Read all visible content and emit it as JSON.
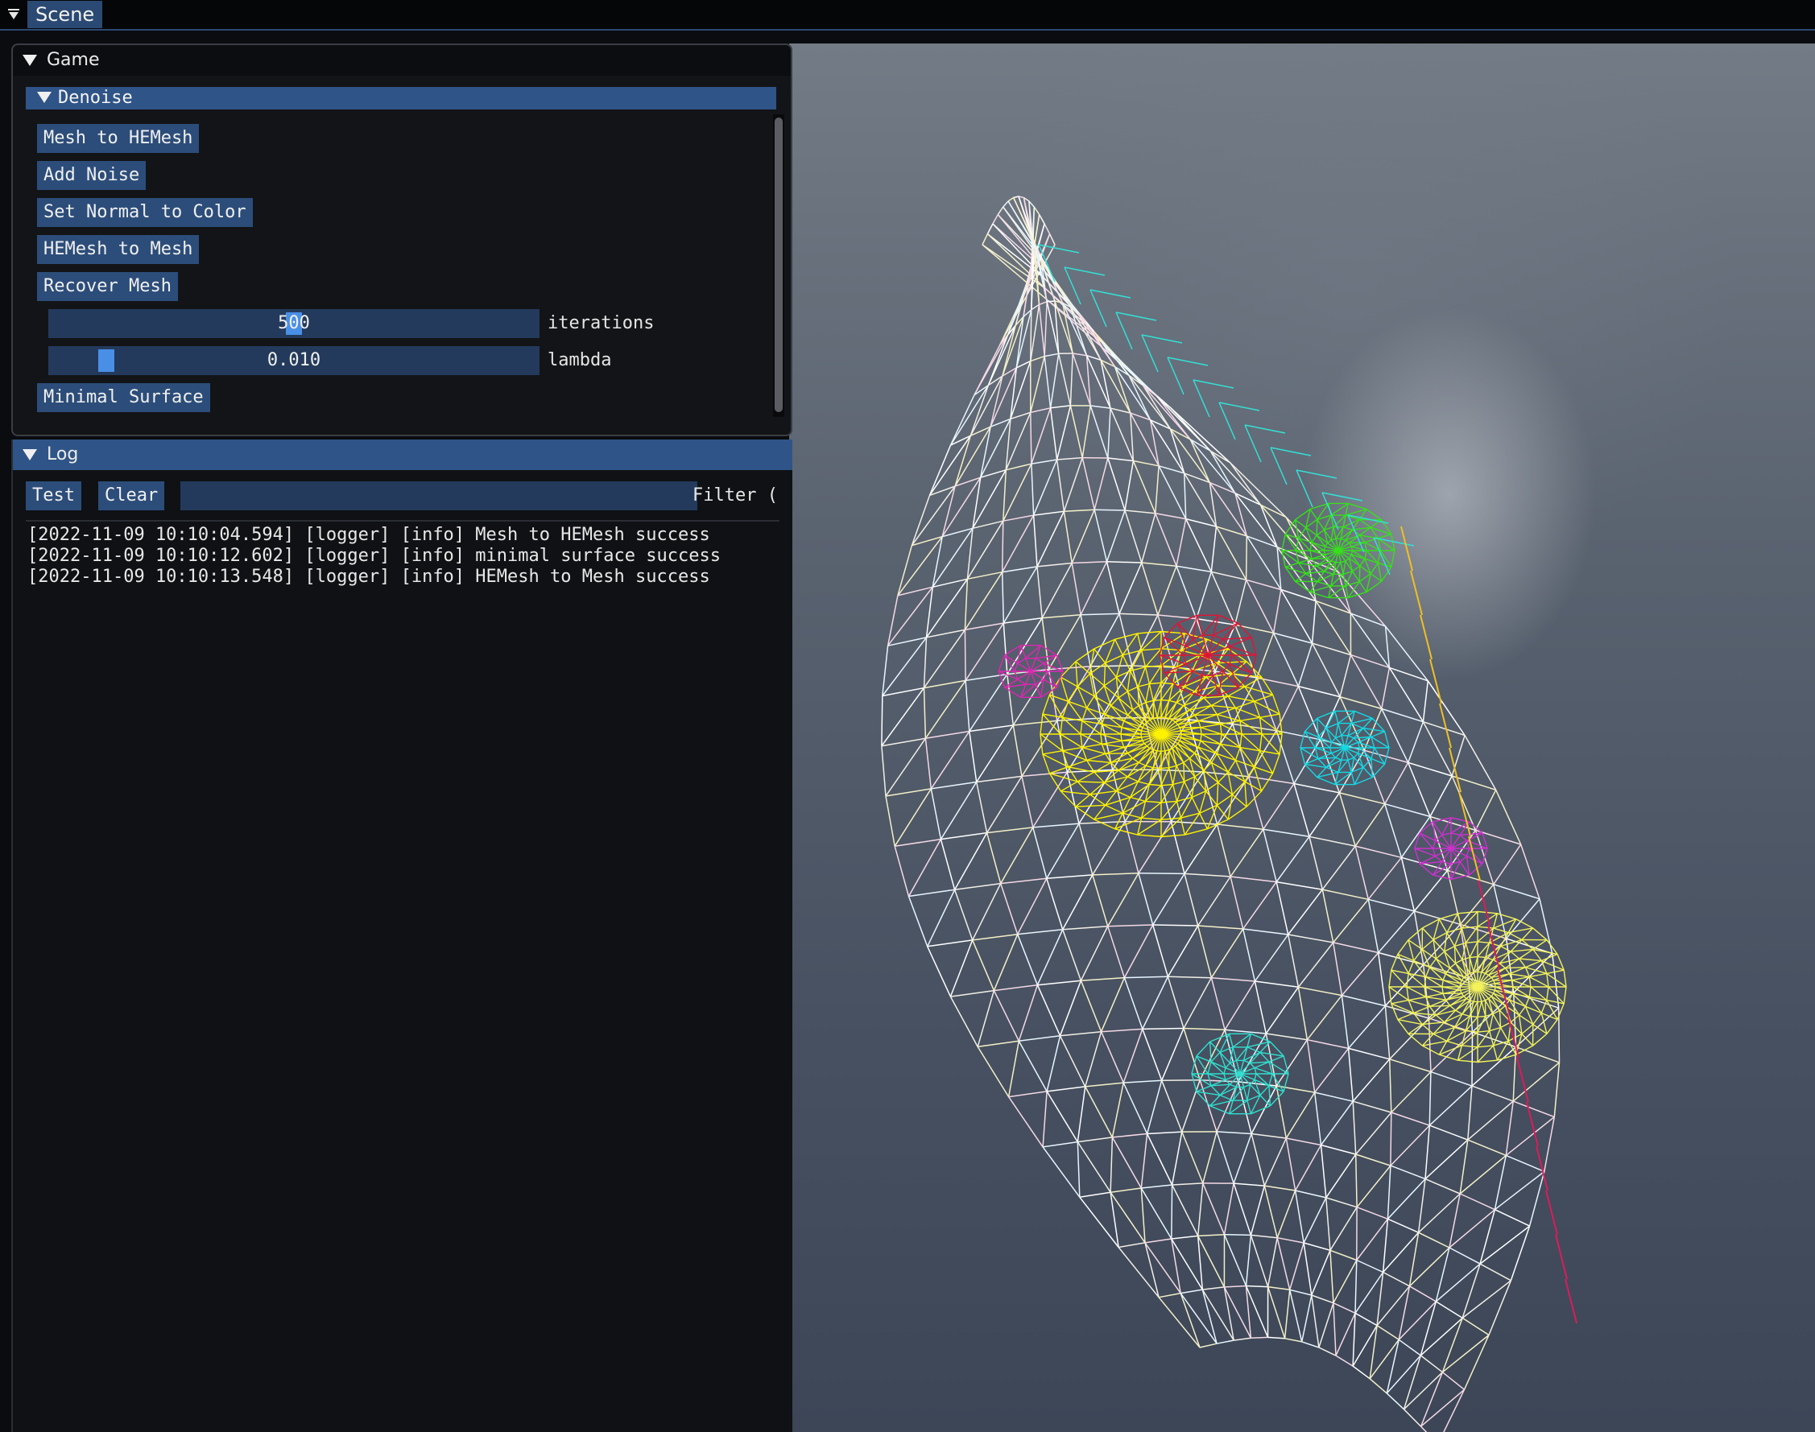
{
  "scene_tab": "Scene",
  "game": {
    "title": "Game",
    "section": "Denoise",
    "buttons": [
      "Mesh to HEMesh",
      "Add Noise",
      "Set Normal to Color",
      "HEMesh to Mesh",
      "Recover Mesh"
    ],
    "iterations": {
      "value": "500",
      "label": "iterations",
      "level": 0.5
    },
    "lambda": {
      "value": "0.010",
      "label": "lambda",
      "level": 0.1
    },
    "minimal_button": "Minimal Surface"
  },
  "log": {
    "title": "Log",
    "test_label": "Test",
    "clear_label": "Clear",
    "filter_label": "Filter (",
    "filter_value": "",
    "lines": [
      "[2022-11-09 10:10:04.594] [logger] [info] Mesh to HEMesh success",
      "[2022-11-09 10:10:12.602] [logger] [info] minimal surface success",
      "[2022-11-09 10:10:13.548] [logger] [info] HEMesh to Mesh success"
    ]
  },
  "colors": {
    "accent": "#2f5488",
    "button": "#2c4d7a",
    "slider_grab": "#4a8fe6"
  }
}
